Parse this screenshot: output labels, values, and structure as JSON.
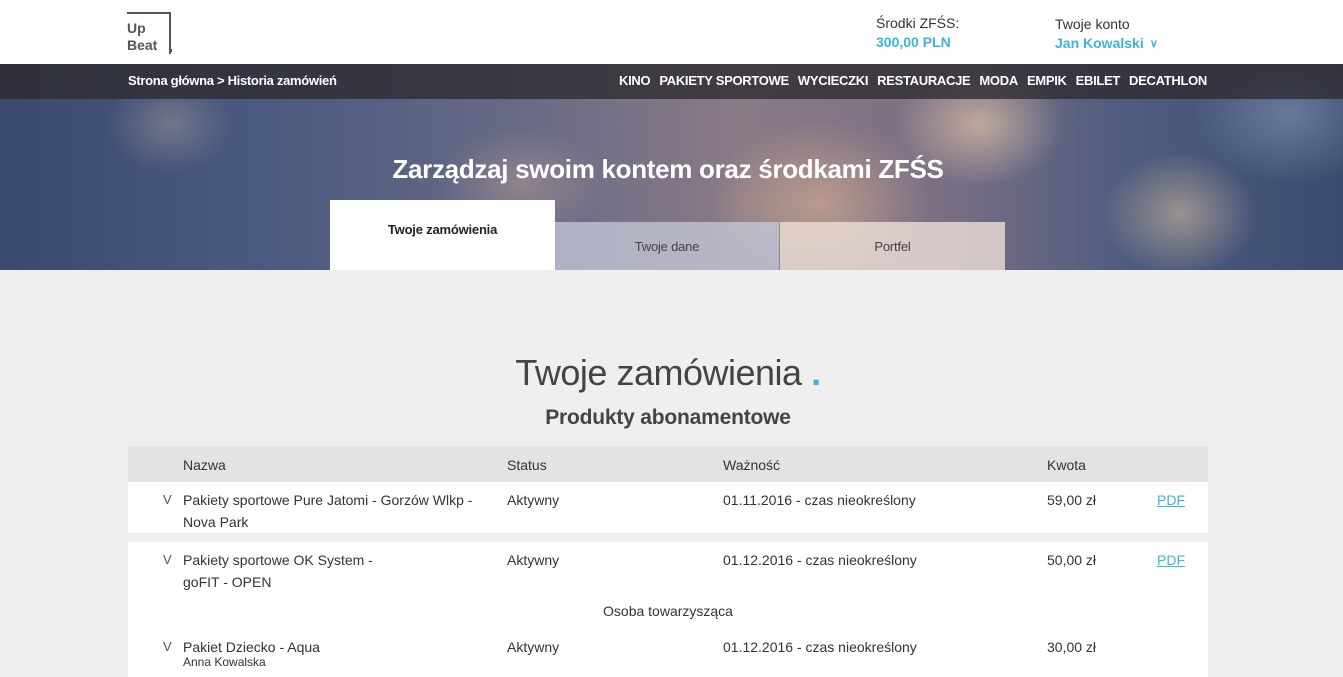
{
  "header": {
    "logo_line1": "Up",
    "logo_line2": "Beat",
    "funds_label": "Środki ZFŚS:",
    "funds_value": "300,00  PLN",
    "account_label": "Twoje konto",
    "account_name": "Jan Kowalski",
    "account_chevron": "∨"
  },
  "nav": {
    "breadcrumb": "Strona główna > Historia zamówień",
    "menu": [
      "KINO",
      "PAKIETY SPORTOWE",
      "WYCIECZKI",
      "RESTAURACJE",
      "MODA",
      "EMPIK",
      "EBILET",
      "DECATHLON"
    ]
  },
  "hero": {
    "title": "Zarządzaj swoim kontem oraz środkami ZFŚS",
    "tabs": [
      "Twoje zamówienia",
      "Twoje dane",
      "Portfel"
    ]
  },
  "main": {
    "title": "Twoje zamówienia",
    "title_accent": ".",
    "subtitle": "Produkty abonamentowe",
    "columns": [
      "Nazwa",
      "Status",
      "Ważność",
      "Kwota"
    ],
    "orders": [
      {
        "chevron": "V",
        "name_line1": "Pakiety sportowe Pure Jatomi - Gorzów Wlkp -",
        "name_line2": "Nova Park",
        "status": "Aktywny",
        "validity": "01.11.2016 - czas nieokreślony",
        "amount": "59,00 zł",
        "pdf": "PDF"
      },
      {
        "chevron": "V",
        "name_line1": "Pakiety sportowe OK System -",
        "name_line2": "goFIT - OPEN",
        "status": "Aktywny",
        "validity": "01.12.2016 - czas nieokreślony",
        "amount": "50,00 zł",
        "pdf": "PDF",
        "companion_label": "Osoba towarzysząca",
        "companion": {
          "chevron": "V",
          "name": "Pakiet Dziecko - Aqua",
          "person": "Anna Kowalska",
          "status": "Aktywny",
          "validity": "01.12.2016 - czas nieokreślony",
          "amount": "30,00 zł"
        }
      }
    ]
  }
}
